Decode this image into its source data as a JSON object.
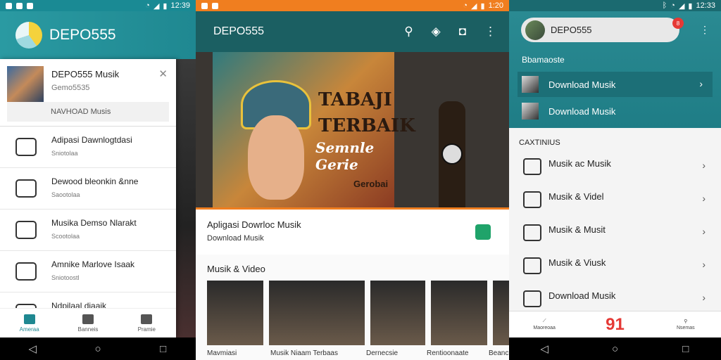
{
  "status": {
    "p1_time": "12:39",
    "p2_time": "1:20",
    "p3_time": "12:33"
  },
  "colors": {
    "teal": "#1f8891",
    "orange": "#f07e1f",
    "dark_teal": "#1b5f62",
    "red": "#e53935"
  },
  "p1": {
    "app_name": "DEPO555",
    "profile": {
      "name": "DEPO555 Musik",
      "sub": "Gemo5535",
      "button": "NAVHOAD Musis"
    },
    "items": [
      {
        "title": "Adipasi Dawnlogtdasi",
        "sub": "Sniotolaa",
        "icon": "chat-icon"
      },
      {
        "title": "Dewood bleonkin &nne",
        "sub": "Saootolaa",
        "icon": "message-icon"
      },
      {
        "title": "Musika Demso Nlarakt",
        "sub": "Scootolaa",
        "icon": "emoji-icon"
      },
      {
        "title": "Amnike Marlove Isaak",
        "sub": "Sniotoostl",
        "icon": "document-icon"
      },
      {
        "title": "Ndpilaal diaaik",
        "sub": "",
        "icon": "book-icon"
      }
    ],
    "bottom_nav": [
      {
        "label": "Ameraa",
        "icon": "home-icon"
      },
      {
        "label": "Banneis",
        "icon": "library-icon"
      },
      {
        "label": "Pramie",
        "icon": "profile-icon"
      }
    ]
  },
  "p2": {
    "title": "DEPO555",
    "hero": {
      "line1": "TABAJI",
      "line2": "TERBAIK",
      "line3": "Semnle Gerie",
      "line4": "Gerobai"
    },
    "featured": {
      "title": "Apligasi Dowrloc Musik",
      "sub": "Download Musik"
    },
    "section_title": "Musik & Video",
    "thumbs": [
      {
        "caption": "Mavmiasi",
        "w": 80
      },
      {
        "caption": "Musik Niaam Terbaas",
        "w": 136
      },
      {
        "caption": "Dernecsie",
        "w": 78
      },
      {
        "caption": "Rentioonaate",
        "w": 80
      },
      {
        "caption": "Beanc",
        "w": 40
      }
    ]
  },
  "p3": {
    "profile_name": "DEPO555",
    "badge": "8",
    "section": "Bbamaoste",
    "downloads": [
      "Download Musik",
      "Download Musik"
    ],
    "category_label": "CAXTINIUS",
    "categories": [
      {
        "label": "Musik ac Musik",
        "icon": "speech-icon"
      },
      {
        "label": "Musik & Videl",
        "icon": "video-icon"
      },
      {
        "label": "Musik & Musit",
        "icon": "music-icon"
      },
      {
        "label": "Musik & Viusk",
        "icon": "gear-icon"
      },
      {
        "label": "Download Musik",
        "icon": "download-icon"
      }
    ],
    "bottom_nav": [
      {
        "label": "Maoreoaa",
        "icon": "chart-icon"
      },
      {
        "label": "91",
        "icon": "logo-icon"
      },
      {
        "label": "Nsemas",
        "icon": "search-icon"
      }
    ]
  }
}
